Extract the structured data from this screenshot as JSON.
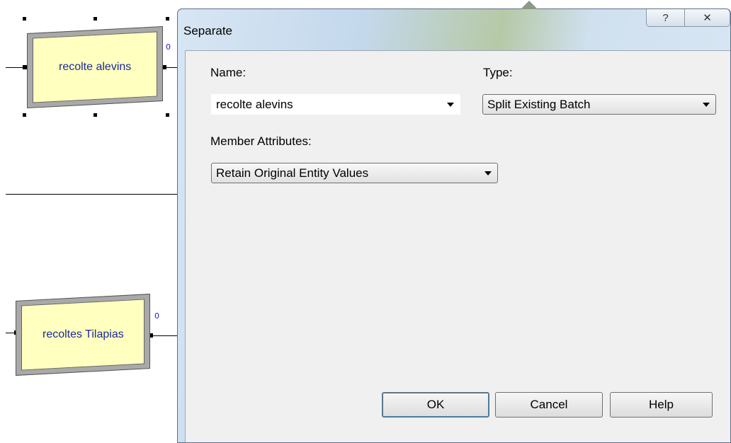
{
  "canvas": {
    "modules": [
      {
        "label": "recolte alevins",
        "counter": "0"
      },
      {
        "label": "recoltes Tilapias",
        "counter": "0"
      }
    ]
  },
  "dialog": {
    "title": "Separate",
    "help_glyph": "?",
    "close_glyph": "✕",
    "name_label": "Name:",
    "name_value": "recolte alevins",
    "type_label": "Type:",
    "type_value": "Split Existing Batch",
    "member_attr_label": "Member Attributes:",
    "member_attr_value": "Retain Original Entity Values",
    "buttons": {
      "ok": "OK",
      "cancel": "Cancel",
      "help": "Help"
    }
  },
  "colors": {
    "module_fill": "#ffffc0",
    "module_text": "#1a2a9a",
    "counter_text": "#2020d0"
  }
}
